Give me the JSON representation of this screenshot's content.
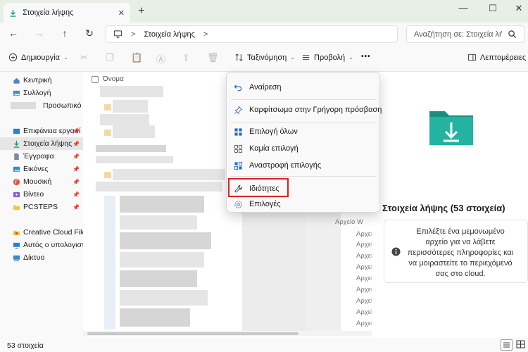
{
  "window": {
    "tab_title": "Στοιχεία λήψης",
    "new_tab": "+",
    "minimize": "—",
    "maximize": "☐",
    "close": "✕"
  },
  "nav": {
    "back": "←",
    "forward": "→",
    "up": "↑",
    "refresh": "↻",
    "breadcrumb_location": "Στοιχεία λήψης",
    "breadcrumb_sep": ">",
    "search_placeholder": "Αναζήτηση σε: Στοιχεία λήψ"
  },
  "toolbar": {
    "new_label": "Δημιουργία",
    "sort_label": "Ταξινόμηση",
    "view_label": "Προβολή",
    "more_label": "•••",
    "details_label": "Λεπτομέρειες"
  },
  "sidebar": {
    "items": [
      {
        "label": "Κεντρική"
      },
      {
        "label": "Συλλογή"
      },
      {
        "label": "Προσωπικό"
      },
      {
        "label": "Επιφάνεια εργασί"
      },
      {
        "label": "Στοιχεία λήψης"
      },
      {
        "label": "Έγγραφα"
      },
      {
        "label": "Εικόνες"
      },
      {
        "label": "Μουσική"
      },
      {
        "label": "Βίντεο"
      },
      {
        "label": "PCSTEPS"
      },
      {
        "label": "Creative Cloud Files F"
      },
      {
        "label": "Αυτός ο υπολογιστή"
      },
      {
        "label": "Δίκτυο"
      }
    ]
  },
  "list": {
    "column_name": "Όνομα",
    "type_prefixes": [
      "Αρχείο W",
      "Αρχείο W",
      "Αρχείο W",
      "Αρχείο W",
      "Αρχείο W",
      "Αρχείο W",
      "Αρχείο W",
      "Αρχείο PI",
      "Αρχείο PI",
      "Αρχείο W",
      "Αρχείο AV",
      "Αρχείο AV"
    ]
  },
  "context_menu": {
    "items": [
      {
        "label": "Αναίρεση",
        "icon": "undo-icon"
      },
      {
        "label": "Καρφίτσωμα στην Γρήγορη πρόσβαση",
        "icon": "pin-icon"
      },
      {
        "label": "Επιλογή όλων",
        "icon": "select-all-icon"
      },
      {
        "label": "Καμία επιλογή",
        "icon": "select-none-icon"
      },
      {
        "label": "Αναστροφή επιλογής",
        "icon": "invert-selection-icon"
      },
      {
        "label": "Ιδιότητες",
        "icon": "wrench-icon"
      },
      {
        "label": "Επιλογές",
        "icon": "options-gear-icon"
      }
    ]
  },
  "preview": {
    "title": "Στοιχεία λήψης (53 στοιχεία)",
    "info_text": "Επιλέξτε ένα μεμονωμένο αρχείο για να λάβετε περισσότερες πληροφορίες και να μοιραστείτε το περιεχόμενό σας στο cloud."
  },
  "status": {
    "item_count": "53 στοιχεία"
  },
  "colors": {
    "accent": "#0067c0",
    "highlight_box": "#e02020",
    "folder_teal": "#1f9f8f",
    "titlebar": "#e8efe4"
  }
}
